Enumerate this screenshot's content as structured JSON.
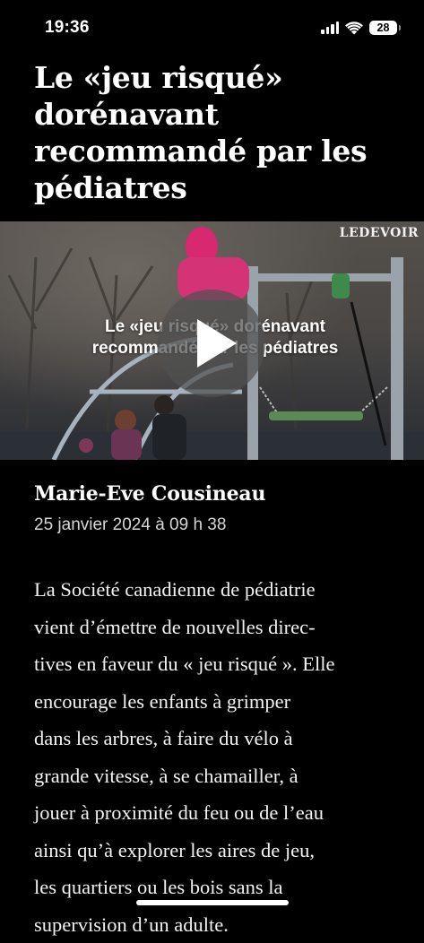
{
  "status": {
    "time": "19:36",
    "battery": "28"
  },
  "article": {
    "title": "Le «jeu risqué» dorénavant recommandé par les pédiatres",
    "video": {
      "brand": "LEDEVOIR",
      "caption_line1": "Le «jeu risqué» dorénavant",
      "caption_line2": "recommandé par les pédiatres"
    },
    "author": "Marie-Eve Cousineau",
    "date": "25 janvier 2024 à 09 h 38",
    "body_lines": [
      "La Société canadienne de pédiatrie",
      "vient d’émettre de nouvelles direc-",
      "tives en faveur du « jeu risqué ». Elle",
      "encourage les enfants à grimper",
      "dans les arbres, à faire du vélo à",
      "grande vitesse, à se chamailler, à",
      "jouer à proximité du feu ou de l’eau",
      "ainsi qu’à explorer les aires de jeu,",
      "les quartiers ou les bois sans la",
      "supervision d’un adulte."
    ]
  },
  "colors": {
    "background": "#000000",
    "text": "#ffffff",
    "date_text": "#d6d6d6"
  },
  "icons": [
    "signal-icon",
    "wifi-icon",
    "battery-icon",
    "play-icon"
  ]
}
